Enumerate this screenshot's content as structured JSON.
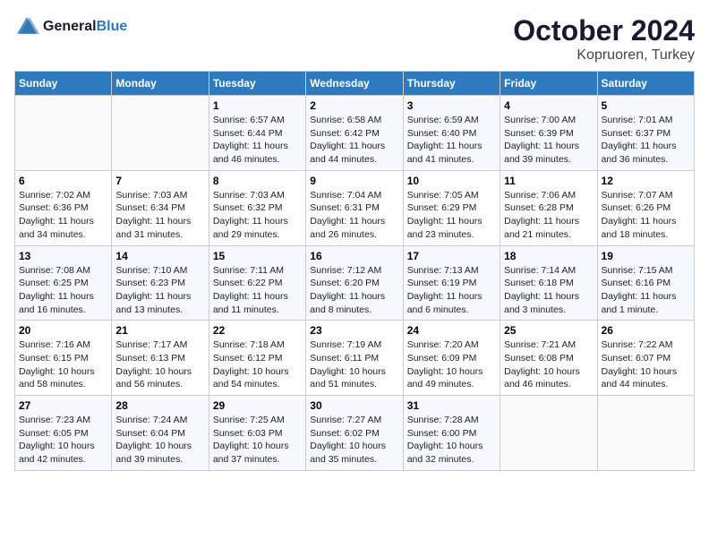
{
  "logo": {
    "line1": "General",
    "line2": "Blue"
  },
  "title": "October 2024",
  "location": "Kopruoren, Turkey",
  "days_of_week": [
    "Sunday",
    "Monday",
    "Tuesday",
    "Wednesday",
    "Thursday",
    "Friday",
    "Saturday"
  ],
  "weeks": [
    [
      {
        "day": "",
        "content": ""
      },
      {
        "day": "",
        "content": ""
      },
      {
        "day": "1",
        "content": "Sunrise: 6:57 AM\nSunset: 6:44 PM\nDaylight: 11 hours and 46 minutes."
      },
      {
        "day": "2",
        "content": "Sunrise: 6:58 AM\nSunset: 6:42 PM\nDaylight: 11 hours and 44 minutes."
      },
      {
        "day": "3",
        "content": "Sunrise: 6:59 AM\nSunset: 6:40 PM\nDaylight: 11 hours and 41 minutes."
      },
      {
        "day": "4",
        "content": "Sunrise: 7:00 AM\nSunset: 6:39 PM\nDaylight: 11 hours and 39 minutes."
      },
      {
        "day": "5",
        "content": "Sunrise: 7:01 AM\nSunset: 6:37 PM\nDaylight: 11 hours and 36 minutes."
      }
    ],
    [
      {
        "day": "6",
        "content": "Sunrise: 7:02 AM\nSunset: 6:36 PM\nDaylight: 11 hours and 34 minutes."
      },
      {
        "day": "7",
        "content": "Sunrise: 7:03 AM\nSunset: 6:34 PM\nDaylight: 11 hours and 31 minutes."
      },
      {
        "day": "8",
        "content": "Sunrise: 7:03 AM\nSunset: 6:32 PM\nDaylight: 11 hours and 29 minutes."
      },
      {
        "day": "9",
        "content": "Sunrise: 7:04 AM\nSunset: 6:31 PM\nDaylight: 11 hours and 26 minutes."
      },
      {
        "day": "10",
        "content": "Sunrise: 7:05 AM\nSunset: 6:29 PM\nDaylight: 11 hours and 23 minutes."
      },
      {
        "day": "11",
        "content": "Sunrise: 7:06 AM\nSunset: 6:28 PM\nDaylight: 11 hours and 21 minutes."
      },
      {
        "day": "12",
        "content": "Sunrise: 7:07 AM\nSunset: 6:26 PM\nDaylight: 11 hours and 18 minutes."
      }
    ],
    [
      {
        "day": "13",
        "content": "Sunrise: 7:08 AM\nSunset: 6:25 PM\nDaylight: 11 hours and 16 minutes."
      },
      {
        "day": "14",
        "content": "Sunrise: 7:10 AM\nSunset: 6:23 PM\nDaylight: 11 hours and 13 minutes."
      },
      {
        "day": "15",
        "content": "Sunrise: 7:11 AM\nSunset: 6:22 PM\nDaylight: 11 hours and 11 minutes."
      },
      {
        "day": "16",
        "content": "Sunrise: 7:12 AM\nSunset: 6:20 PM\nDaylight: 11 hours and 8 minutes."
      },
      {
        "day": "17",
        "content": "Sunrise: 7:13 AM\nSunset: 6:19 PM\nDaylight: 11 hours and 6 minutes."
      },
      {
        "day": "18",
        "content": "Sunrise: 7:14 AM\nSunset: 6:18 PM\nDaylight: 11 hours and 3 minutes."
      },
      {
        "day": "19",
        "content": "Sunrise: 7:15 AM\nSunset: 6:16 PM\nDaylight: 11 hours and 1 minute."
      }
    ],
    [
      {
        "day": "20",
        "content": "Sunrise: 7:16 AM\nSunset: 6:15 PM\nDaylight: 10 hours and 58 minutes."
      },
      {
        "day": "21",
        "content": "Sunrise: 7:17 AM\nSunset: 6:13 PM\nDaylight: 10 hours and 56 minutes."
      },
      {
        "day": "22",
        "content": "Sunrise: 7:18 AM\nSunset: 6:12 PM\nDaylight: 10 hours and 54 minutes."
      },
      {
        "day": "23",
        "content": "Sunrise: 7:19 AM\nSunset: 6:11 PM\nDaylight: 10 hours and 51 minutes."
      },
      {
        "day": "24",
        "content": "Sunrise: 7:20 AM\nSunset: 6:09 PM\nDaylight: 10 hours and 49 minutes."
      },
      {
        "day": "25",
        "content": "Sunrise: 7:21 AM\nSunset: 6:08 PM\nDaylight: 10 hours and 46 minutes."
      },
      {
        "day": "26",
        "content": "Sunrise: 7:22 AM\nSunset: 6:07 PM\nDaylight: 10 hours and 44 minutes."
      }
    ],
    [
      {
        "day": "27",
        "content": "Sunrise: 7:23 AM\nSunset: 6:05 PM\nDaylight: 10 hours and 42 minutes."
      },
      {
        "day": "28",
        "content": "Sunrise: 7:24 AM\nSunset: 6:04 PM\nDaylight: 10 hours and 39 minutes."
      },
      {
        "day": "29",
        "content": "Sunrise: 7:25 AM\nSunset: 6:03 PM\nDaylight: 10 hours and 37 minutes."
      },
      {
        "day": "30",
        "content": "Sunrise: 7:27 AM\nSunset: 6:02 PM\nDaylight: 10 hours and 35 minutes."
      },
      {
        "day": "31",
        "content": "Sunrise: 7:28 AM\nSunset: 6:00 PM\nDaylight: 10 hours and 32 minutes."
      },
      {
        "day": "",
        "content": ""
      },
      {
        "day": "",
        "content": ""
      }
    ]
  ]
}
